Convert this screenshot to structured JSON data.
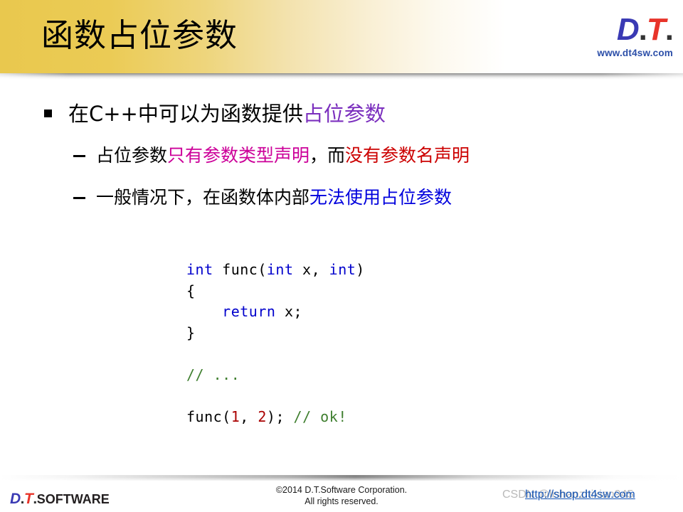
{
  "header": {
    "title": "函数占位参数",
    "logo": {
      "d_text": "D",
      "dot1": ".",
      "t_text": "T",
      "dot2": ".",
      "url": "www.dt4sw.com"
    }
  },
  "content": {
    "bullet1": {
      "part_black": "在C++中可以为函数提供",
      "part_purple": "占位参数"
    },
    "bullet2": {
      "part_black_1": "占位参数",
      "part_magenta": "只有参数类型声明",
      "part_black_2": "，而",
      "part_red": "没有参数名声明"
    },
    "bullet3": {
      "part_black": "一般情况下，在函数体内部",
      "part_blue": "无法使用占位参数"
    }
  },
  "code": {
    "line1_kw1": "int",
    "line1_p1": " func(",
    "line1_kw2": "int",
    "line1_p2": " x, ",
    "line1_kw3": "int",
    "line1_p3": ")",
    "line2": "{",
    "line3_indent": "    ",
    "line3_kw": "return",
    "line3_rest": " x;",
    "line4": "}",
    "line5_comment": "// ...",
    "line6_p1": "func(",
    "line6_num1": "1",
    "line6_p2": ", ",
    "line6_num2": "2",
    "line6_p3": "); ",
    "line6_comment": "// ok!"
  },
  "footer": {
    "logo_d": "D",
    "logo_dot1": ".",
    "logo_t": "T",
    "logo_dot2": ".",
    "logo_software_s": "S",
    "logo_software_rest": "OFTWARE",
    "copyright_line1": "©2014 D.T.Software Corporation.",
    "copyright_line2": "All rights reserved.",
    "watermark": "CSDN @lishanzhixian945",
    "shop_link": "http://shop.dt4sw.com"
  },
  "colors": {
    "header_gold": "#e9c84e",
    "accent_purple": "#7b2fbe",
    "accent_magenta": "#cc0099",
    "accent_red": "#cc0000",
    "accent_blue": "#0000dd",
    "code_keyword": "#0000cc",
    "code_comment": "#3f7f2f",
    "code_number": "#aa0000",
    "logo_blue": "#3a3ab4",
    "logo_red": "#e8342a",
    "link_blue": "#1353b4"
  }
}
